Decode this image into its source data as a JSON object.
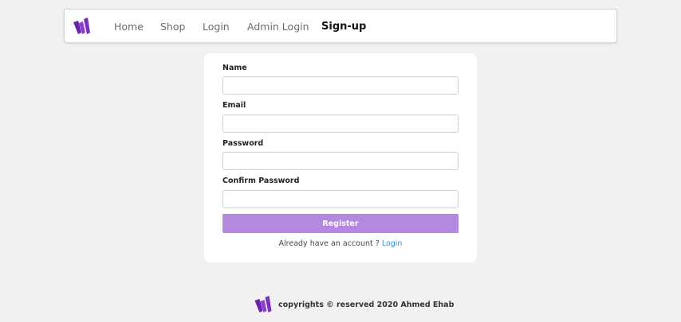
{
  "nav": {
    "logo_icon": "w-logo-icon",
    "brand_color": "#7b2fbf",
    "links": [
      {
        "label": "Home"
      },
      {
        "label": "Shop"
      },
      {
        "label": "Login"
      },
      {
        "label": "Admin Login"
      },
      {
        "label": "Sign-up",
        "active": true
      }
    ]
  },
  "form": {
    "fields": [
      {
        "label": "Name",
        "value": "",
        "placeholder": ""
      },
      {
        "label": "Email",
        "value": "",
        "placeholder": ""
      },
      {
        "label": "Password",
        "value": "",
        "placeholder": ""
      },
      {
        "label": "Confirm Password",
        "value": "",
        "placeholder": ""
      }
    ],
    "submit_label": "Register",
    "submit_color": "#b388dd",
    "account_prompt": "Already have an account ?",
    "login_link": "Login",
    "link_color": "#3b8fd6"
  },
  "footer": {
    "text": "copyrights © reserved 2020 Ahmed Ehab"
  }
}
